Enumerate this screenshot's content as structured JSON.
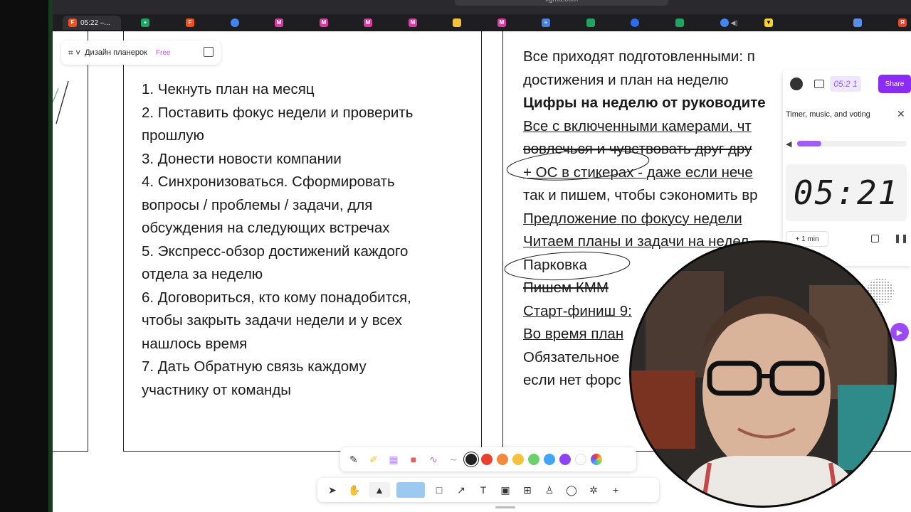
{
  "browser": {
    "url": "figma.com",
    "active_tab_title": "05:22 –...",
    "tab_icons": [
      "sheets-icon",
      "figma-icon",
      "chrome-icon",
      "miro-icon",
      "miro-icon",
      "miro-icon",
      "miro-icon",
      "notes-icon",
      "miro-icon",
      "docs-icon",
      "sheets-icon",
      "pen-icon",
      "sheets-icon",
      "chrome-icon",
      "speaker-icon",
      "bee-icon",
      "window-icon",
      "yandex-icon"
    ]
  },
  "file": {
    "name": "Дизайн планерок",
    "plan_badge": "Free"
  },
  "header": {
    "timer_chip": "05:2 1",
    "share_label": "Share"
  },
  "agenda": {
    "lines": [
      "1. Чекнуть план на месяц",
      "2. Поставить фокус недели и проверить",
      "прошлую",
      "3. Донести новости компании",
      "4. Синхронизоваться. Сформировать",
      "вопросы / проблемы / задачи, для",
      "обсуждения на следующих встречах",
      "5. Экспресс-обзор достижений каждого",
      "отдела за неделю",
      "6. Договориться, кто кому понадобится,",
      "чтобы закрыть задачи недели и у всех",
      "нашлось время",
      "7. Дать Обратную связь каждому",
      "участнику от команды"
    ]
  },
  "rules": {
    "lines": [
      "Все приходят подготовленными: п",
      "достижения и план на неделю",
      "Цифры на неделю от руководите",
      "Все с включенными камерами, чт",
      "вовлечься и чувствовать друг дру",
      "+ ОС  в стикерах - даже если нече",
      "так и пишем, чтобы сэкономить вр",
      "Предложение по фокусу недели",
      "Читаем планы и задачи на недел",
      "Парковка",
      "Пишем КММ",
      "Старт-финиш 9:",
      "Во время план",
      "Обязательное",
      "если нет форс"
    ]
  },
  "timer_panel": {
    "title": "Timer, music, and voting",
    "volume_fraction": 0.22,
    "clock": "05:21",
    "add_label": "+ 1 min"
  },
  "colors": {
    "palette": [
      "#222222",
      "#e8412c",
      "#f28a3c",
      "#f5c33b",
      "#6cd06b",
      "#42a5f5",
      "#8e44f5",
      "#ffffff",
      "#rainbow"
    ],
    "accent": "#8b2cf5"
  },
  "toolbar": {
    "tools": [
      "pointer-icon",
      "hand-icon",
      "marker-icon",
      "shape-icon",
      "connector-icon",
      "text-icon",
      "sticky-icon",
      "table-icon",
      "stamp-icon",
      "comment-icon",
      "widget-icon",
      "add-icon"
    ]
  }
}
